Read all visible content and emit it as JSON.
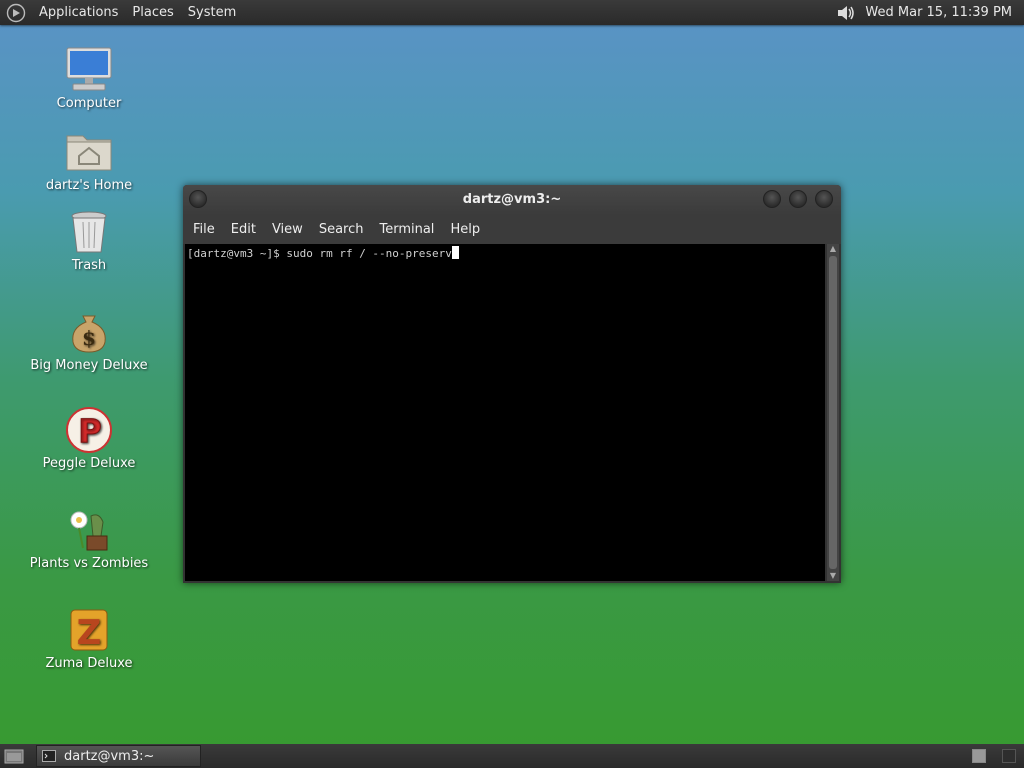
{
  "top_panel": {
    "menus": [
      "Applications",
      "Places",
      "System"
    ],
    "clock": "Wed Mar 15, 11:39 PM",
    "icons": {
      "logo": "gnome-foot-icon",
      "volume": "volume-icon"
    }
  },
  "desktop_icons": [
    {
      "label": "Computer",
      "icon": "computer-icon"
    },
    {
      "label": "dartz's Home",
      "icon": "home-folder-icon"
    },
    {
      "label": "Trash",
      "icon": "trash-icon"
    },
    {
      "label": "Big Money Deluxe",
      "icon": "money-bag-icon"
    },
    {
      "label": "Peggle Deluxe",
      "icon": "peggle-icon"
    },
    {
      "label": "Plants vs Zombies",
      "icon": "plants-vs-zombies-icon"
    },
    {
      "label": "Zuma Deluxe",
      "icon": "zuma-icon"
    }
  ],
  "terminal": {
    "title": "dartz@vm3:~",
    "menu": [
      "File",
      "Edit",
      "View",
      "Search",
      "Terminal",
      "Help"
    ],
    "prompt": "[dartz@vm3 ~]$ ",
    "command": "sudo rm rf / --no-preserv"
  },
  "taskbar": {
    "window_button": "dartz@vm3:~",
    "workspaces": 2
  },
  "colors": {
    "panel": "#2f2f2f",
    "terminal_bg": "#000000",
    "terminal_text": "#d0d0d0"
  }
}
